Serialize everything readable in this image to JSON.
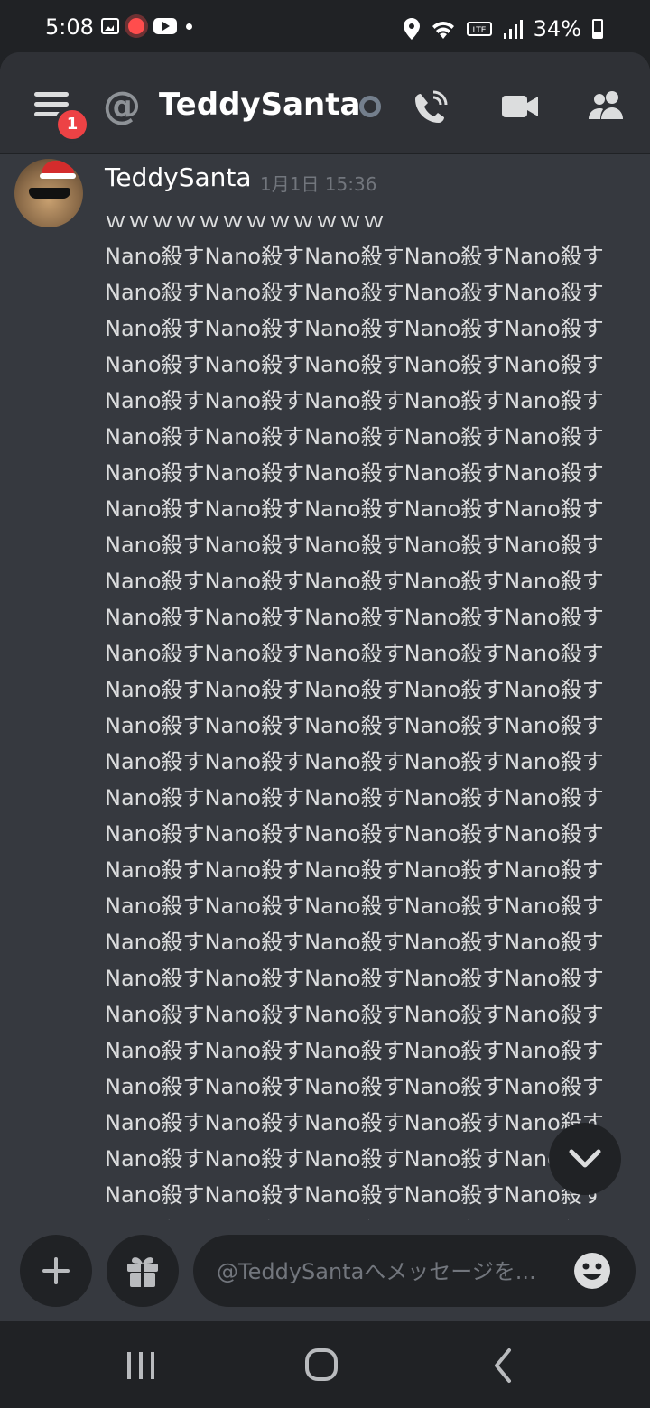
{
  "status_bar": {
    "time": "5:08",
    "battery": "34%",
    "left_icons": [
      "gallery-icon",
      "sun-notification-icon",
      "youtube-icon",
      "more-dot-icon"
    ],
    "right_icons": [
      "location-icon",
      "wifi-icon",
      "volte-icon",
      "signal-icon",
      "battery-icon"
    ]
  },
  "header": {
    "channel_name": "TeddySanta",
    "notification_count": "1",
    "status": "offline"
  },
  "message": {
    "author": "TeddySanta",
    "timestamp": "1月1日 15:36",
    "first_line": "ｗｗｗｗｗｗｗｗｗｗｗｗ",
    "body": "Nano殺すNano殺すNano殺すNano殺すNano殺すNano殺すNano殺すNano殺すNano殺すNano殺すNano殺すNano殺すNano殺すNano殺すNano殺すNano殺すNano殺すNano殺すNano殺すNano殺すNano殺すNano殺すNano殺すNano殺すNano殺すNano殺すNano殺すNano殺すNano殺すNano殺すNano殺すNano殺すNano殺すNano殺すNano殺すNano殺すNano殺すNano殺すNano殺すNano殺すNano殺すNano殺すNano殺すNano殺すNano殺すNano殺すNano殺すNano殺すNano殺すNano殺すNano殺すNano殺すNano殺すNano殺すNano殺すNano殺すNano殺すNano殺すNano殺すNano殺すNano殺すNano殺すNano殺すNano殺すNano殺すNano殺すNano殺すNano殺すNano殺すNano殺すNano殺すNano殺すNano殺すNano殺すNano殺すNano殺すNano殺すNano殺すNano殺すNano殺すNano殺すNano殺すNano殺すNano殺すNano殺すNano殺すNano殺すNano殺すNano殺すNano殺すNano殺すNano殺すNano殺すNano殺すNano殺すNano殺すNano殺すNano殺すNano殺すNano殺すNano殺すNano殺すNano殺すNano殺すNano殺すNano殺すNano殺すNano殺すNano殺すNano殺すNano殺すNano殺すNano殺すNano殺すNano殺すNano殺すNano殺すNano殺すNano殺すNano殺すNano殺すNano殺すNano殺すNano殺すNano殺すNano殺すNano殺すNano殺すNano殺すNano殺すNano殺すNano殺すNano殺すNano殺すNano殺すNano殺すNano殺すNano殺すNano殺すNano殺すNano殺すNano殺すNano殺すNano殺す"
  },
  "composer": {
    "placeholder": "@TeddySantaへメッセージを..."
  },
  "colors": {
    "background": "#36393f",
    "header": "#2f3136",
    "dark": "#202225",
    "badge": "#ed4245",
    "text": "#dcddde",
    "muted": "#72767d"
  }
}
